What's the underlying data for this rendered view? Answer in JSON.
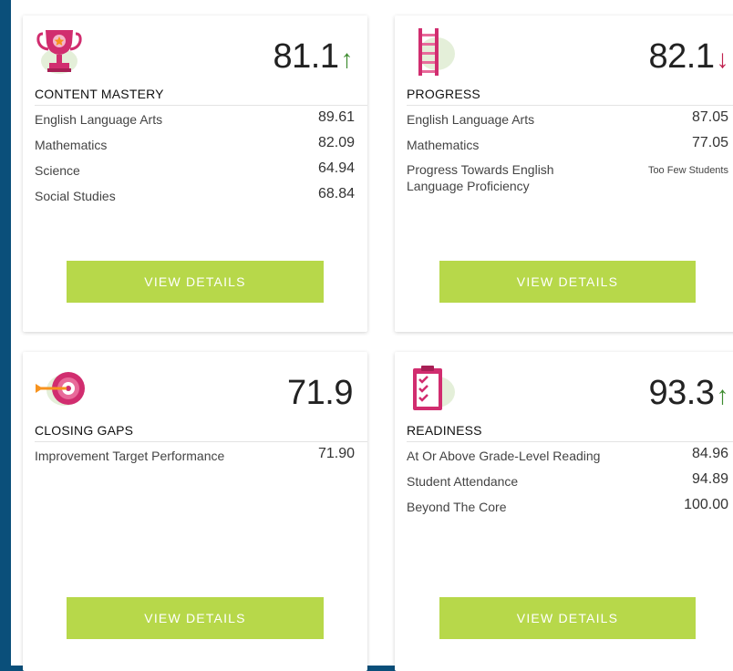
{
  "colors": {
    "page_background": "#0a4f7a",
    "button": "#b7d84a",
    "up_arrow": "#3d8b2e",
    "down_arrow": "#c0224f",
    "icon_accent": "#d12d6f"
  },
  "cards": [
    {
      "title": "CONTENT MASTERY",
      "score": "81.1",
      "trend": "up",
      "trend_glyph": "↑",
      "icon": "trophy-icon",
      "metrics": [
        {
          "label": "English Language Arts",
          "value": "89.61"
        },
        {
          "label": "Mathematics",
          "value": "82.09"
        },
        {
          "label": "Science",
          "value": "64.94"
        },
        {
          "label": "Social Studies",
          "value": "68.84"
        }
      ],
      "button": "VIEW DETAILS"
    },
    {
      "title": "PROGRESS",
      "score": "82.1",
      "trend": "down",
      "trend_glyph": "↓",
      "icon": "ladder-icon",
      "metrics": [
        {
          "label": "English Language Arts",
          "value": "87.05"
        },
        {
          "label": "Mathematics",
          "value": "77.05"
        },
        {
          "label": "Progress Towards English Language Proficiency",
          "value": "Too Few Students"
        }
      ],
      "button": "VIEW DETAILS"
    },
    {
      "title": "CLOSING GAPS",
      "score": "71.9",
      "trend": "none",
      "trend_glyph": "",
      "icon": "target-icon",
      "metrics": [
        {
          "label": "Improvement Target Performance",
          "value": "71.90"
        }
      ],
      "button": "VIEW DETAILS"
    },
    {
      "title": "READINESS",
      "score": "93.3",
      "trend": "up",
      "trend_glyph": "↑",
      "icon": "clipboard-checklist-icon",
      "metrics": [
        {
          "label": "At Or Above Grade-Level Reading",
          "value": "84.96"
        },
        {
          "label": "Student Attendance",
          "value": "94.89"
        },
        {
          "label": "Beyond The Core",
          "value": "100.00"
        }
      ],
      "button": "VIEW DETAILS"
    }
  ]
}
